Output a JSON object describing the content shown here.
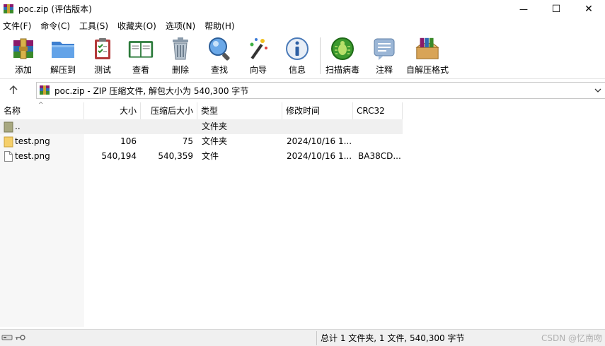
{
  "window": {
    "title": "poc.zip (评估版本)",
    "minimize_glyph": "—",
    "maximize_glyph": "☐",
    "close_glyph": "✕"
  },
  "menu": [
    "文件(F)",
    "命令(C)",
    "工具(S)",
    "收藏夹(O)",
    "选项(N)",
    "帮助(H)"
  ],
  "toolbar": {
    "buttons": [
      {
        "label": "添加",
        "icon": "add-archive-icon"
      },
      {
        "label": "解压到",
        "icon": "extract-to-icon"
      },
      {
        "label": "测试",
        "icon": "test-icon"
      },
      {
        "label": "查看",
        "icon": "view-icon"
      },
      {
        "label": "删除",
        "icon": "delete-icon"
      },
      {
        "label": "查找",
        "icon": "find-icon"
      },
      {
        "label": "向导",
        "icon": "wizard-icon"
      },
      {
        "label": "信息",
        "icon": "info-icon"
      },
      {
        "label": "扫描病毒",
        "icon": "virus-scan-icon"
      },
      {
        "label": "注释",
        "icon": "comment-icon"
      },
      {
        "label": "自解压格式",
        "icon": "sfx-icon"
      }
    ]
  },
  "address": {
    "path": "poc.zip - ZIP 压缩文件, 解包大小为 540,300 字节"
  },
  "list": {
    "columns": [
      "名称",
      "大小",
      "压缩后大小",
      "类型",
      "修改时间",
      "CRC32"
    ],
    "rows": [
      {
        "name": "..",
        "size": "",
        "packed": "",
        "type": "文件夹",
        "modified": "",
        "crc": "",
        "icon": "parent-folder-icon"
      },
      {
        "name": "test.png",
        "size": "106",
        "packed": "75",
        "type": "文件夹",
        "modified": "2024/10/16 1...",
        "crc": "",
        "icon": "folder-icon"
      },
      {
        "name": "test.png",
        "size": "540,194",
        "packed": "540,359",
        "type": "文件",
        "modified": "2024/10/16 1...",
        "crc": "BA38CD...",
        "icon": "file-icon"
      }
    ]
  },
  "status": {
    "summary": "总计 1 文件夹, 1 文件, 540,300 字节",
    "watermark": "CSDN @忆南吻"
  }
}
